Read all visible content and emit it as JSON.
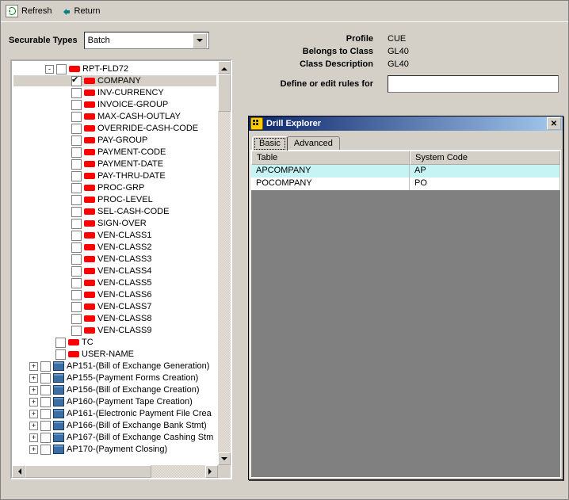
{
  "toolbar": {
    "refresh": "Refresh",
    "return": "Return"
  },
  "securable_label": "Securable Types",
  "securable_value": "Batch",
  "info": {
    "profile_lbl": "Profile",
    "profile_val": "CUE",
    "class_lbl": "Belongs to Class",
    "class_val": "GL40",
    "desc_lbl": "Class Description",
    "desc_val": "GL40",
    "define_lbl": "Define or edit rules for"
  },
  "tree": [
    {
      "indent": 40,
      "exp": "-",
      "chk": false,
      "icon": "def",
      "label": "RPT-FLD72",
      "hl": false
    },
    {
      "indent": 60,
      "chk": true,
      "icon": "def",
      "label": "COMPANY",
      "hl": true
    },
    {
      "indent": 60,
      "chk": false,
      "icon": "def",
      "label": "INV-CURRENCY"
    },
    {
      "indent": 60,
      "chk": false,
      "icon": "def",
      "label": "INVOICE-GROUP"
    },
    {
      "indent": 60,
      "chk": false,
      "icon": "def",
      "label": "MAX-CASH-OUTLAY"
    },
    {
      "indent": 60,
      "chk": false,
      "icon": "def",
      "label": "OVERRIDE-CASH-CODE"
    },
    {
      "indent": 60,
      "chk": false,
      "icon": "def",
      "label": "PAY-GROUP"
    },
    {
      "indent": 60,
      "chk": false,
      "icon": "def",
      "label": "PAYMENT-CODE"
    },
    {
      "indent": 60,
      "chk": false,
      "icon": "def",
      "label": "PAYMENT-DATE"
    },
    {
      "indent": 60,
      "chk": false,
      "icon": "def",
      "label": "PAY-THRU-DATE"
    },
    {
      "indent": 60,
      "chk": false,
      "icon": "def",
      "label": "PROC-GRP"
    },
    {
      "indent": 60,
      "chk": false,
      "icon": "def",
      "label": "PROC-LEVEL"
    },
    {
      "indent": 60,
      "chk": false,
      "icon": "def",
      "label": "SEL-CASH-CODE"
    },
    {
      "indent": 60,
      "chk": false,
      "icon": "def",
      "label": "SIGN-OVER"
    },
    {
      "indent": 60,
      "chk": false,
      "icon": "def",
      "label": "VEN-CLASS1"
    },
    {
      "indent": 60,
      "chk": false,
      "icon": "def",
      "label": "VEN-CLASS2"
    },
    {
      "indent": 60,
      "chk": false,
      "icon": "def",
      "label": "VEN-CLASS3"
    },
    {
      "indent": 60,
      "chk": false,
      "icon": "def",
      "label": "VEN-CLASS4"
    },
    {
      "indent": 60,
      "chk": false,
      "icon": "def",
      "label": "VEN-CLASS5"
    },
    {
      "indent": 60,
      "chk": false,
      "icon": "def",
      "label": "VEN-CLASS6"
    },
    {
      "indent": 60,
      "chk": false,
      "icon": "def",
      "label": "VEN-CLASS7"
    },
    {
      "indent": 60,
      "chk": false,
      "icon": "def",
      "label": "VEN-CLASS8"
    },
    {
      "indent": 60,
      "chk": false,
      "icon": "def",
      "label": "VEN-CLASS9"
    },
    {
      "indent": 40,
      "chk": false,
      "icon": "def",
      "label": "TC"
    },
    {
      "indent": 40,
      "chk": false,
      "icon": "def",
      "label": "USER-NAME"
    },
    {
      "indent": 20,
      "exp": "+",
      "chk": false,
      "icon": "form",
      "label": "AP151-(Bill of Exchange Generation)"
    },
    {
      "indent": 20,
      "exp": "+",
      "chk": false,
      "icon": "form",
      "label": "AP155-(Payment Forms Creation)"
    },
    {
      "indent": 20,
      "exp": "+",
      "chk": false,
      "icon": "form",
      "label": "AP156-(Bill of Exchange Creation)"
    },
    {
      "indent": 20,
      "exp": "+",
      "chk": false,
      "icon": "form",
      "label": "AP160-(Payment Tape Creation)"
    },
    {
      "indent": 20,
      "exp": "+",
      "chk": false,
      "icon": "form",
      "label": "AP161-(Electronic Payment File Crea"
    },
    {
      "indent": 20,
      "exp": "+",
      "chk": false,
      "icon": "form",
      "label": "AP166-(Bill of Exchange Bank Stmt)"
    },
    {
      "indent": 20,
      "exp": "+",
      "chk": false,
      "icon": "form",
      "label": "AP167-(Bill of Exchange Cashing Stm"
    },
    {
      "indent": 20,
      "exp": "+",
      "chk": false,
      "icon": "form",
      "label": "AP170-(Payment Closing)"
    }
  ],
  "drill": {
    "title": "Drill Explorer",
    "tabs": {
      "basic": "Basic",
      "advanced": "Advanced"
    },
    "cols": {
      "table": "Table",
      "code": "System Code"
    },
    "rows": [
      {
        "table": "APCOMPANY",
        "code": "AP",
        "sel": true
      },
      {
        "table": "POCOMPANY",
        "code": "PO",
        "sel": false
      }
    ]
  }
}
